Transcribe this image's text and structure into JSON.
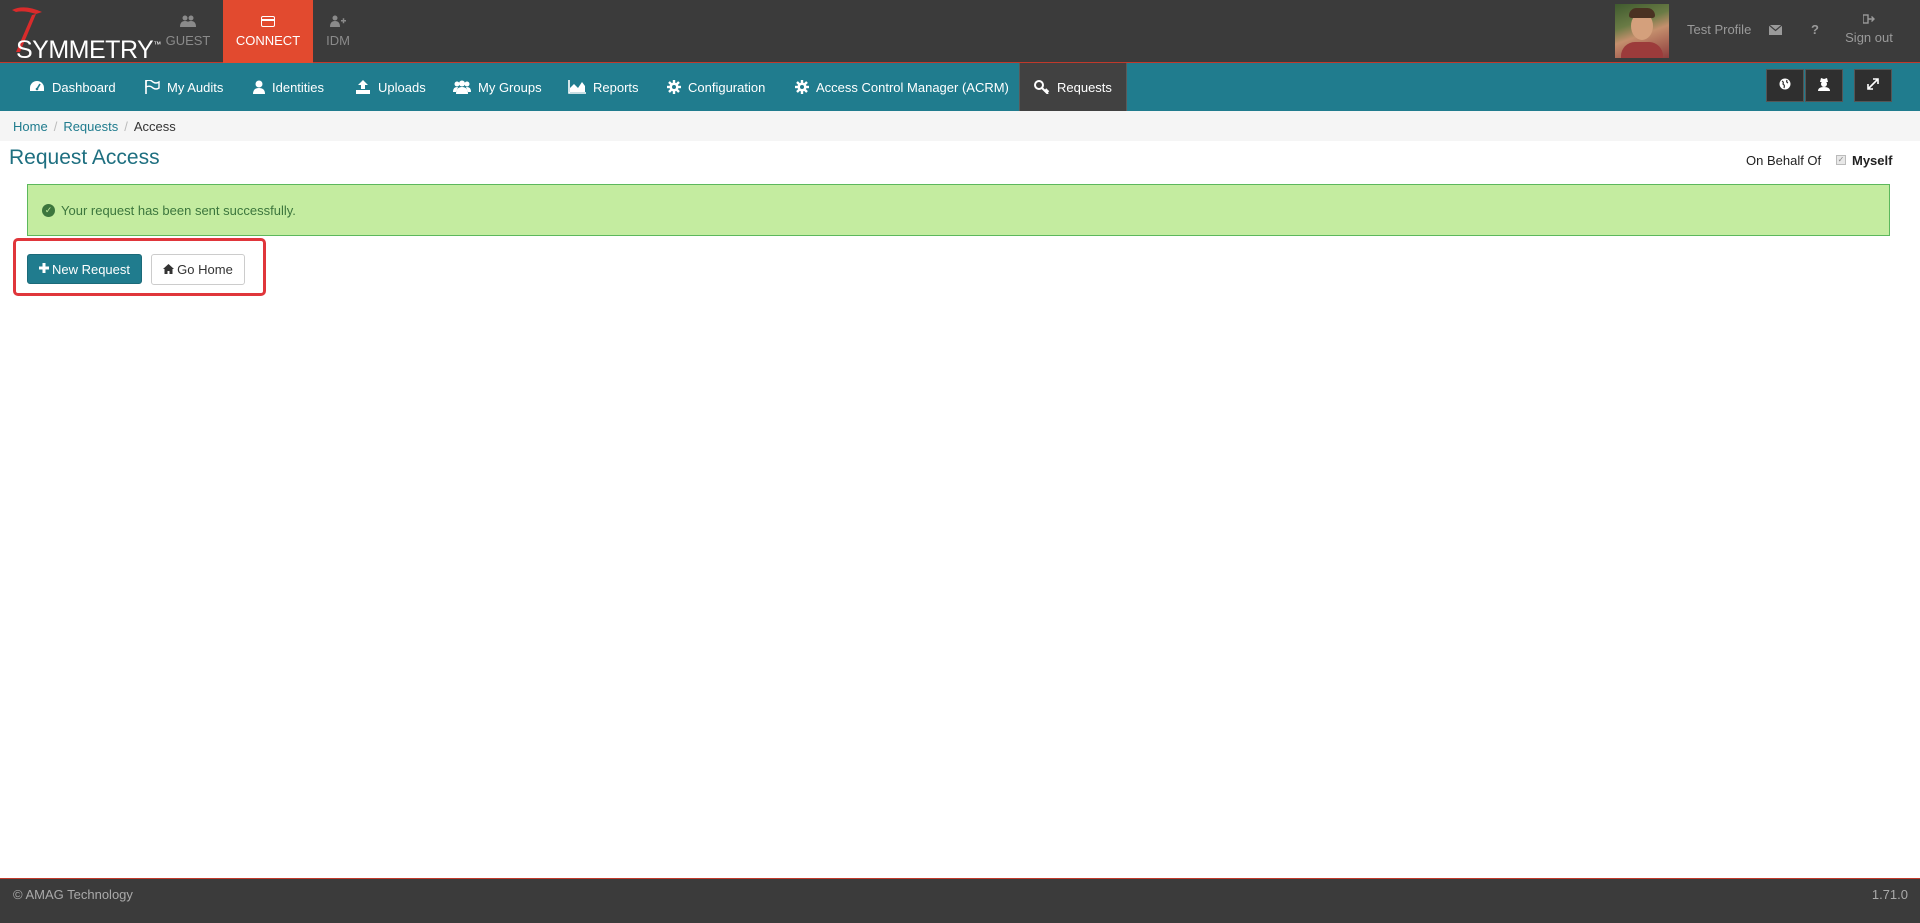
{
  "brand": {
    "name": "SYMMETRY",
    "tm": "™"
  },
  "apps": [
    {
      "label": "GUEST",
      "icon": "users-icon"
    },
    {
      "label": "CONNECT",
      "icon": "card-icon",
      "active": true
    },
    {
      "label": "IDM",
      "icon": "user-plus-icon"
    }
  ],
  "user": {
    "name": "Test Profile",
    "help": "?",
    "signout": "Sign out"
  },
  "nav": {
    "items": [
      {
        "label": "Dashboard",
        "icon": "dashboard-icon"
      },
      {
        "label": "My Audits",
        "icon": "flag-icon"
      },
      {
        "label": "Identities",
        "icon": "user-icon"
      },
      {
        "label": "Uploads",
        "icon": "upload-icon"
      },
      {
        "label": "My Groups",
        "icon": "group-icon"
      },
      {
        "label": "Reports",
        "icon": "area-chart-icon"
      },
      {
        "label": "Configuration",
        "icon": "gear-icon"
      },
      {
        "label": "Access Control Manager (ACRM)",
        "icon": "gear-icon"
      },
      {
        "label": "Requests",
        "icon": "key-icon",
        "active": true
      }
    ]
  },
  "breadcrumb": {
    "home": "Home",
    "requests": "Requests",
    "current": "Access",
    "separator": "/"
  },
  "page": {
    "title": "Request Access",
    "on_behalf_label": "On Behalf Of",
    "on_behalf_value": "Myself",
    "alert": "Your request has been sent successfully.",
    "new_request": "New Request",
    "go_home": "Go Home"
  },
  "footer": {
    "copyright": "© AMAG Technology",
    "version": "1.71.0"
  },
  "colors": {
    "nav": "#207c8e",
    "active_app": "#e24a2f",
    "alert_bg": "#c4eca0",
    "highlight": "#e0363b"
  }
}
